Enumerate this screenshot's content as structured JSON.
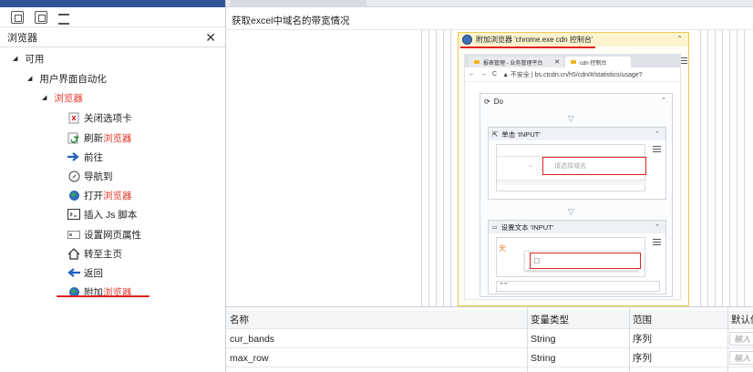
{
  "left_panel": {
    "search_value": "浏览器",
    "tree": [
      {
        "label": "可用"
      },
      {
        "label": "用户界面自动化"
      },
      {
        "label": "浏览器"
      },
      {
        "label_a": "关闭选项卡",
        "label_b": ""
      },
      {
        "label_a": "刷新",
        "label_b": "浏览器"
      },
      {
        "label_a": "前往",
        "label_b": ""
      },
      {
        "label_a": "导航到",
        "label_b": ""
      },
      {
        "label_a": "打开",
        "label_b": "浏览器"
      },
      {
        "label_a": "插入 Js 脚本",
        "label_b": ""
      },
      {
        "label_a": "设置网页属性",
        "label_b": ""
      },
      {
        "label_a": "转至主页",
        "label_b": ""
      },
      {
        "label_a": "返回",
        "label_b": ""
      },
      {
        "label_a": "附加",
        "label_b": "浏览器"
      }
    ]
  },
  "main": {
    "title": "获取excel中域名的带宽情况",
    "attach_label": "附加浏览器 'chrome.exe cdn 控制台'",
    "browser": {
      "tab1": "报表管理 - 业务管理平台",
      "tab2": "cdn 控制台",
      "address": "▲ 不安全 | bs.ctcdn.cn/h5/cdn/#/statistics/usage?"
    },
    "do_label": "Do",
    "click_label": "单击 'INPUT'",
    "click_placeholder": "请选择域名",
    "settext_label": "设置文本 'INPUT'",
    "settext_snippet": "天",
    "settext_value": "\" \""
  },
  "variables": {
    "headers": [
      "名称",
      "变量类型",
      "范围",
      "默认值"
    ],
    "rows": [
      {
        "name": "cur_bands",
        "type": "String",
        "scope": "序列",
        "default": "输入"
      },
      {
        "name": "max_row",
        "type": "String",
        "scope": "序列",
        "default": "输入"
      }
    ]
  },
  "colors": {
    "highlight_red": "#e23b2e",
    "underline_red": "#e02020",
    "attach_border": "#f0c84a"
  }
}
